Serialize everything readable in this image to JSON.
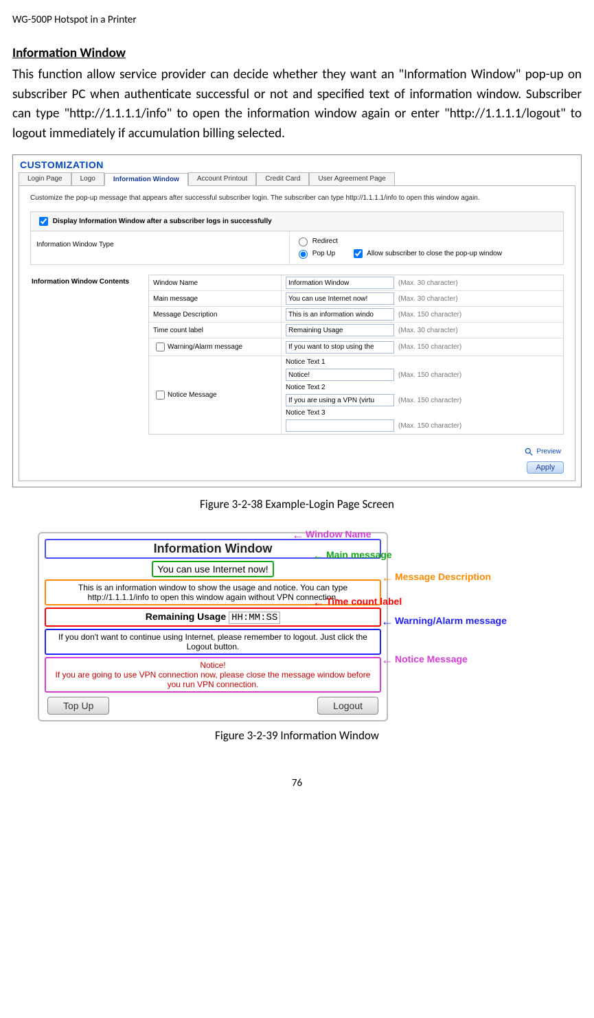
{
  "header": "WG-500P Hotspot in a Printer",
  "section_title": "Information Window",
  "body_paragraph": "This function allow service provider can decide whether they want an \"Information Window\" pop-up on subscriber PC when authenticate successful or not and specified text of information window. Subscriber can type \"http://1.1.1.1/info\" to open the information window again or enter \"http://1.1.1.1/logout\" to logout immediately if accumulation billing selected.",
  "screenshot1": {
    "page_heading": "CUSTOMIZATION",
    "tabs": {
      "login_page": "Login Page",
      "logo": "Logo",
      "info_window": "Information Window",
      "account_printout": "Account Printout",
      "credit_card": "Credit Card",
      "user_agreement": "User Agreement Page"
    },
    "help_text": "Customize the pop-up message that appears after successful subscriber login. The subscriber can type http://1.1.1.1/info to open this window again.",
    "display_checkbox_label": "Display Information Window after a subscriber logs in successfully",
    "type_row": {
      "label": "Information Window Type",
      "opt_redirect": "Redirect",
      "opt_popup": "Pop Up",
      "allow_close": "Allow subscriber to close the pop-up window"
    },
    "contents_label": "Information Window Contents",
    "rows": {
      "window_name": {
        "label": "Window Name",
        "value": "Information Window",
        "hint": "(Max. 30 character)"
      },
      "main_message": {
        "label": "Main message",
        "value": "You can use Internet now!",
        "hint": "(Max. 30 character)"
      },
      "msg_desc": {
        "label": "Message Description",
        "value": "This is an information windo",
        "hint": "(Max. 150 character)"
      },
      "time_count": {
        "label": "Time count label",
        "value": "Remaining Usage",
        "hint": "(Max. 30 character)"
      },
      "warning": {
        "label": "Warning/Alarm message",
        "value": "If you want to stop using the",
        "hint": "(Max. 150 character)"
      },
      "notice": {
        "label": "Notice Message",
        "t1_label": "Notice Text 1",
        "t1_value": "Notice!",
        "t2_label": "Notice Text 2",
        "t2_value": "If you are using a VPN (virtu",
        "t3_label": "Notice Text 3",
        "t3_value": "",
        "hint": "(Max. 150 character)"
      }
    },
    "preview_label": "Preview",
    "apply_label": "Apply"
  },
  "figure1_caption": "Figure 3-2-38 Example-Login Page Screen",
  "screenshot2": {
    "title": "Information Window",
    "main_msg": "You can use Internet now!",
    "desc": "This is an information window to show the usage and notice. You can type http://1.1.1.1/info to open this window again without VPN connection.",
    "time_label": "Remaining Usage",
    "time_value": "HH:MM:SS",
    "warn": "If you don't want to continue using Internet, please remember to logout. Just click the Logout button.",
    "notice_title": "Notice!",
    "notice_body": "If you are going to use VPN connection now, please close the message window before you run VPN connection.",
    "btn_topup": "Top Up",
    "btn_logout": "Logout",
    "annot": {
      "window_name": "Window Name",
      "main_message": "Main message",
      "msg_desc": "Message Description",
      "time_count": "Time count label",
      "warning": "Warning/Alarm message",
      "notice": "Notice Message"
    }
  },
  "figure2_caption": "Figure 3-2-39 Information Window",
  "page_number": "76"
}
